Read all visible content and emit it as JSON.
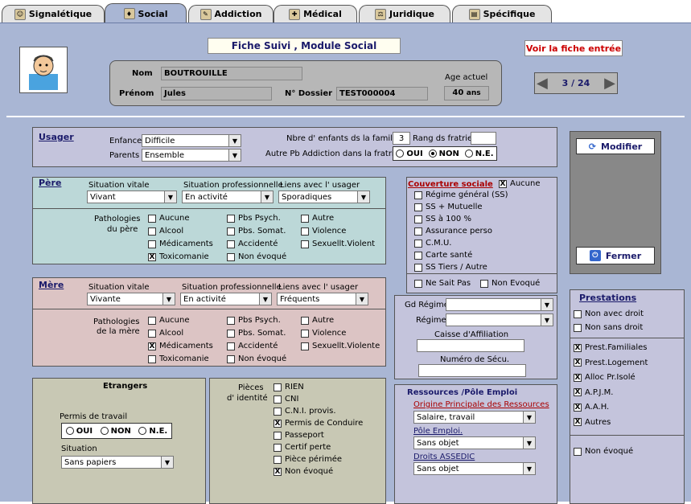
{
  "tabs": [
    {
      "label": "Signalétique",
      "icon": "person-icon"
    },
    {
      "label": "Social",
      "icon": "social-icon",
      "active": true
    },
    {
      "label": "Addiction",
      "icon": "addiction-icon"
    },
    {
      "label": "Médical",
      "icon": "medical-icon"
    },
    {
      "label": "Juridique",
      "icon": "scales-icon"
    },
    {
      "label": "Spécifique",
      "icon": "folder-icon"
    }
  ],
  "header": {
    "title": "Fiche Suivi , Module Social",
    "voir_label": "Voir la fiche entrée",
    "nom_label": "Nom",
    "nom_value": "BOUTROUILLE",
    "prenom_label": "Prénom",
    "prenom_value": "Jules",
    "dossier_label": "N° Dossier",
    "dossier_value": "TEST000004",
    "age_label": "Age actuel",
    "age_value": "40",
    "age_unit": "ans",
    "pager": "3 / 24"
  },
  "usager": {
    "title": "Usager",
    "enfance_label": "Enfance",
    "enfance_value": "Difficile",
    "parents_label": "Parents",
    "parents_value": "Ensemble",
    "nb_enfants_label": "Nbre d' enfants ds la famille",
    "nb_enfants_value": "3",
    "rang_label": "Rang ds fratrie",
    "rang_value": "",
    "autre_pb_label": "Autre Pb Addiction dans la fratrie",
    "options": [
      "OUI",
      "NON",
      "N.E."
    ],
    "selected": "NON"
  },
  "pere": {
    "title": "Père",
    "sit_vitale_label": "Situation vitale",
    "sit_vitale_value": "Vivant",
    "sit_pro_label": "Situation professionnelle",
    "sit_pro_value": "En activité",
    "liens_label": "Liens avec l' usager",
    "liens_value": "Sporadiques",
    "patho_label1": "Pathologies",
    "patho_label2": "du père",
    "items": [
      {
        "label": "Aucune",
        "checked": false
      },
      {
        "label": "Pbs Psych.",
        "checked": false
      },
      {
        "label": "Autre",
        "checked": false
      },
      {
        "label": "Alcool",
        "checked": false
      },
      {
        "label": "Pbs. Somat.",
        "checked": false
      },
      {
        "label": "Violence",
        "checked": false
      },
      {
        "label": "Médicaments",
        "checked": false
      },
      {
        "label": "Accidenté",
        "checked": false
      },
      {
        "label": "Sexuellt.Violent",
        "checked": false
      },
      {
        "label": "Toxicomanie",
        "checked": true
      },
      {
        "label": "Non évoqué",
        "checked": false
      }
    ]
  },
  "mere": {
    "title": "Mère",
    "sit_vitale_label": "Situation vitale",
    "sit_vitale_value": "Vivante",
    "sit_pro_label": "Situation professionnelle",
    "sit_pro_value": "En activité",
    "liens_label": "Liens avec l' usager",
    "liens_value": "Fréquents",
    "patho_label1": "Pathologies",
    "patho_label2": "de la mère",
    "items": [
      {
        "label": "Aucune",
        "checked": false
      },
      {
        "label": "Pbs Psych.",
        "checked": false
      },
      {
        "label": "Autre",
        "checked": false
      },
      {
        "label": "Alcool",
        "checked": false
      },
      {
        "label": "Pbs. Somat.",
        "checked": false
      },
      {
        "label": "Violence",
        "checked": false
      },
      {
        "label": "Médicaments",
        "checked": true
      },
      {
        "label": "Accidenté",
        "checked": false
      },
      {
        "label": "Sexuellt.Violente",
        "checked": false
      },
      {
        "label": "Toxicomanie",
        "checked": false
      },
      {
        "label": "Non évoqué",
        "checked": false
      }
    ]
  },
  "etrangers": {
    "title": "Etrangers",
    "permis_label": "Permis de travail",
    "options": [
      "OUI",
      "NON",
      "N.E."
    ],
    "situation_label": "Situation",
    "situation_value": "Sans papiers"
  },
  "pieces": {
    "label1": "Pièces",
    "label2": "d' identité",
    "items": [
      {
        "label": "RIEN",
        "checked": false
      },
      {
        "label": "CNI",
        "checked": false
      },
      {
        "label": "C.N.I. provis.",
        "checked": false
      },
      {
        "label": "Permis de Conduire",
        "checked": true
      },
      {
        "label": "Passeport",
        "checked": false
      },
      {
        "label": "Certif perte",
        "checked": false
      },
      {
        "label": "Pièce périmée",
        "checked": false
      },
      {
        "label": "Non évoqué",
        "checked": true
      }
    ]
  },
  "couverture": {
    "title": "Couverture sociale",
    "aucune": {
      "label": "Aucune",
      "checked": true
    },
    "items": [
      {
        "label": "Régime général (SS)",
        "checked": false
      },
      {
        "label": "SS + Mutuelle",
        "checked": false
      },
      {
        "label": "SS à 100 %",
        "checked": false
      },
      {
        "label": "Assurance perso",
        "checked": false
      },
      {
        "label": "C.M.U.",
        "checked": false
      },
      {
        "label": "Carte santé",
        "checked": false
      },
      {
        "label": "SS Tiers / Autre",
        "checked": false
      }
    ],
    "ne_sait": {
      "label": "Ne Sait Pas",
      "checked": false
    },
    "non_evoque": {
      "label": "Non Evoqué",
      "checked": false
    }
  },
  "regime": {
    "gd_label": "Gd Régime",
    "regime_label": "Régime",
    "caisse_label": "Caisse d'Affiliation",
    "secu_label": "Numéro de Sécu."
  },
  "ressources": {
    "title": "Ressources /Pôle Emploi",
    "origine_label": "Origine Principale des Ressources",
    "origine_value": "Salaire, travail",
    "pole_label": "Pôle Emploi.",
    "pole_value": "Sans objet",
    "droits_label": "Droits ASSEDIC",
    "droits_value": "Sans objet"
  },
  "actions": {
    "modifier": "Modifier",
    "fermer": "Fermer"
  },
  "prestations": {
    "title": "Prestations",
    "top": [
      {
        "label": "Non avec droit",
        "checked": false
      },
      {
        "label": "Non sans droit",
        "checked": false
      }
    ],
    "items": [
      {
        "label": "Prest.Familiales",
        "checked": true
      },
      {
        "label": "Prest.Logement",
        "checked": true
      },
      {
        "label": "Alloc Pr.Isolé",
        "checked": true
      },
      {
        "label": "A.P.J.M.",
        "checked": true
      },
      {
        "label": "A.A.H.",
        "checked": true
      },
      {
        "label": "Autres",
        "checked": true
      }
    ],
    "non_evoque": {
      "label": "Non évoqué",
      "checked": false
    }
  }
}
